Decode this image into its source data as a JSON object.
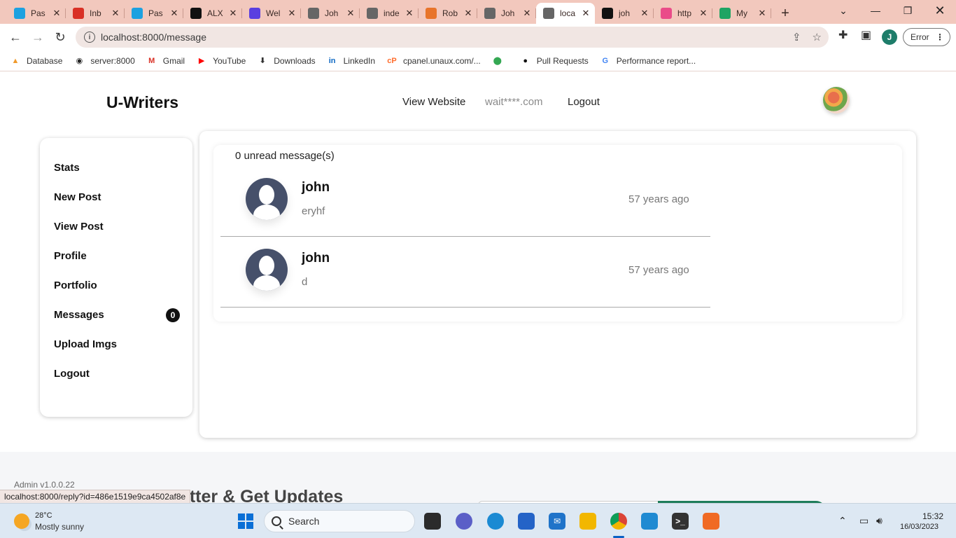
{
  "browser": {
    "tabs": [
      {
        "title": "Pas",
        "icon": "paypal-icon",
        "color": "#1da1e0"
      },
      {
        "title": "Inb",
        "icon": "gmail-icon",
        "color": "#d93025"
      },
      {
        "title": "Pas",
        "icon": "paypal-icon",
        "color": "#1da1e0"
      },
      {
        "title": "ALX",
        "icon": "alx-icon",
        "color": "#111111"
      },
      {
        "title": "Wel",
        "icon": "w-icon",
        "color": "#5a3fe0"
      },
      {
        "title": "Joh",
        "icon": "globe-icon",
        "color": "#666666"
      },
      {
        "title": "inde",
        "icon": "globe-icon",
        "color": "#666666"
      },
      {
        "title": "Rob",
        "icon": "blocks-icon",
        "color": "#e8742a"
      },
      {
        "title": "Joh",
        "icon": "globe-icon",
        "color": "#666666"
      },
      {
        "title": "loca",
        "icon": "globe-icon",
        "color": "#666666"
      },
      {
        "title": "joh",
        "icon": "github-icon",
        "color": "#111111"
      },
      {
        "title": "http",
        "icon": "dribbble-icon",
        "color": "#ea4c89"
      },
      {
        "title": "My",
        "icon": "drive-icon",
        "color": "#1fa463"
      }
    ],
    "active_tab_index": 9,
    "url": "localhost:8000/message",
    "profile_initial": "J",
    "error_label": "Error",
    "bookmarks": [
      {
        "label": "Database",
        "icon": "phpmyadmin-icon"
      },
      {
        "label": "server:8000",
        "icon": "globe-icon"
      },
      {
        "label": "Gmail",
        "icon": "gmail-icon"
      },
      {
        "label": "YouTube",
        "icon": "youtube-icon"
      },
      {
        "label": "Downloads",
        "icon": "download-icon"
      },
      {
        "label": "LinkedIn",
        "icon": "linkedin-icon"
      },
      {
        "label": "cpanel.unaux.com/...",
        "icon": "cpanel-icon"
      },
      {
        "label": "",
        "icon": "maps-icon"
      },
      {
        "label": "Pull Requests",
        "icon": "github-icon"
      },
      {
        "label": "Performance report...",
        "icon": "google-icon"
      }
    ],
    "status_url": "localhost:8000/reply?id=486e1519e9ca4502af8e"
  },
  "site": {
    "brand": "U-Writers",
    "nav": {
      "view_website": "View Website",
      "email": "wait****.com",
      "logout": "Logout"
    }
  },
  "sidebar": {
    "items": [
      {
        "label": "Stats"
      },
      {
        "label": "New Post"
      },
      {
        "label": "View Post"
      },
      {
        "label": "Profile"
      },
      {
        "label": "Portfolio"
      },
      {
        "label": "Messages",
        "badge": "0"
      },
      {
        "label": "Upload Imgs"
      },
      {
        "label": "Logout"
      }
    ]
  },
  "messages": {
    "unread_text": "0 unread message(s)",
    "items": [
      {
        "name": "john",
        "preview": "eryhf",
        "time": "57 years ago"
      },
      {
        "name": "john",
        "preview": "d",
        "time": "57 years ago"
      }
    ]
  },
  "footer": {
    "version": "Admin v1.0.0.22",
    "newsletter_title": "letter & Get Updates"
  },
  "taskbar": {
    "weather_temp": "28°C",
    "weather_desc": "Mostly sunny",
    "search_label": "Search",
    "time": "15:32",
    "date": "16/03/2023"
  },
  "colors": {
    "tab_bar": "#f2c8bd",
    "accent_green": "#1e7d5a",
    "avatar_bg": "#46506a"
  }
}
